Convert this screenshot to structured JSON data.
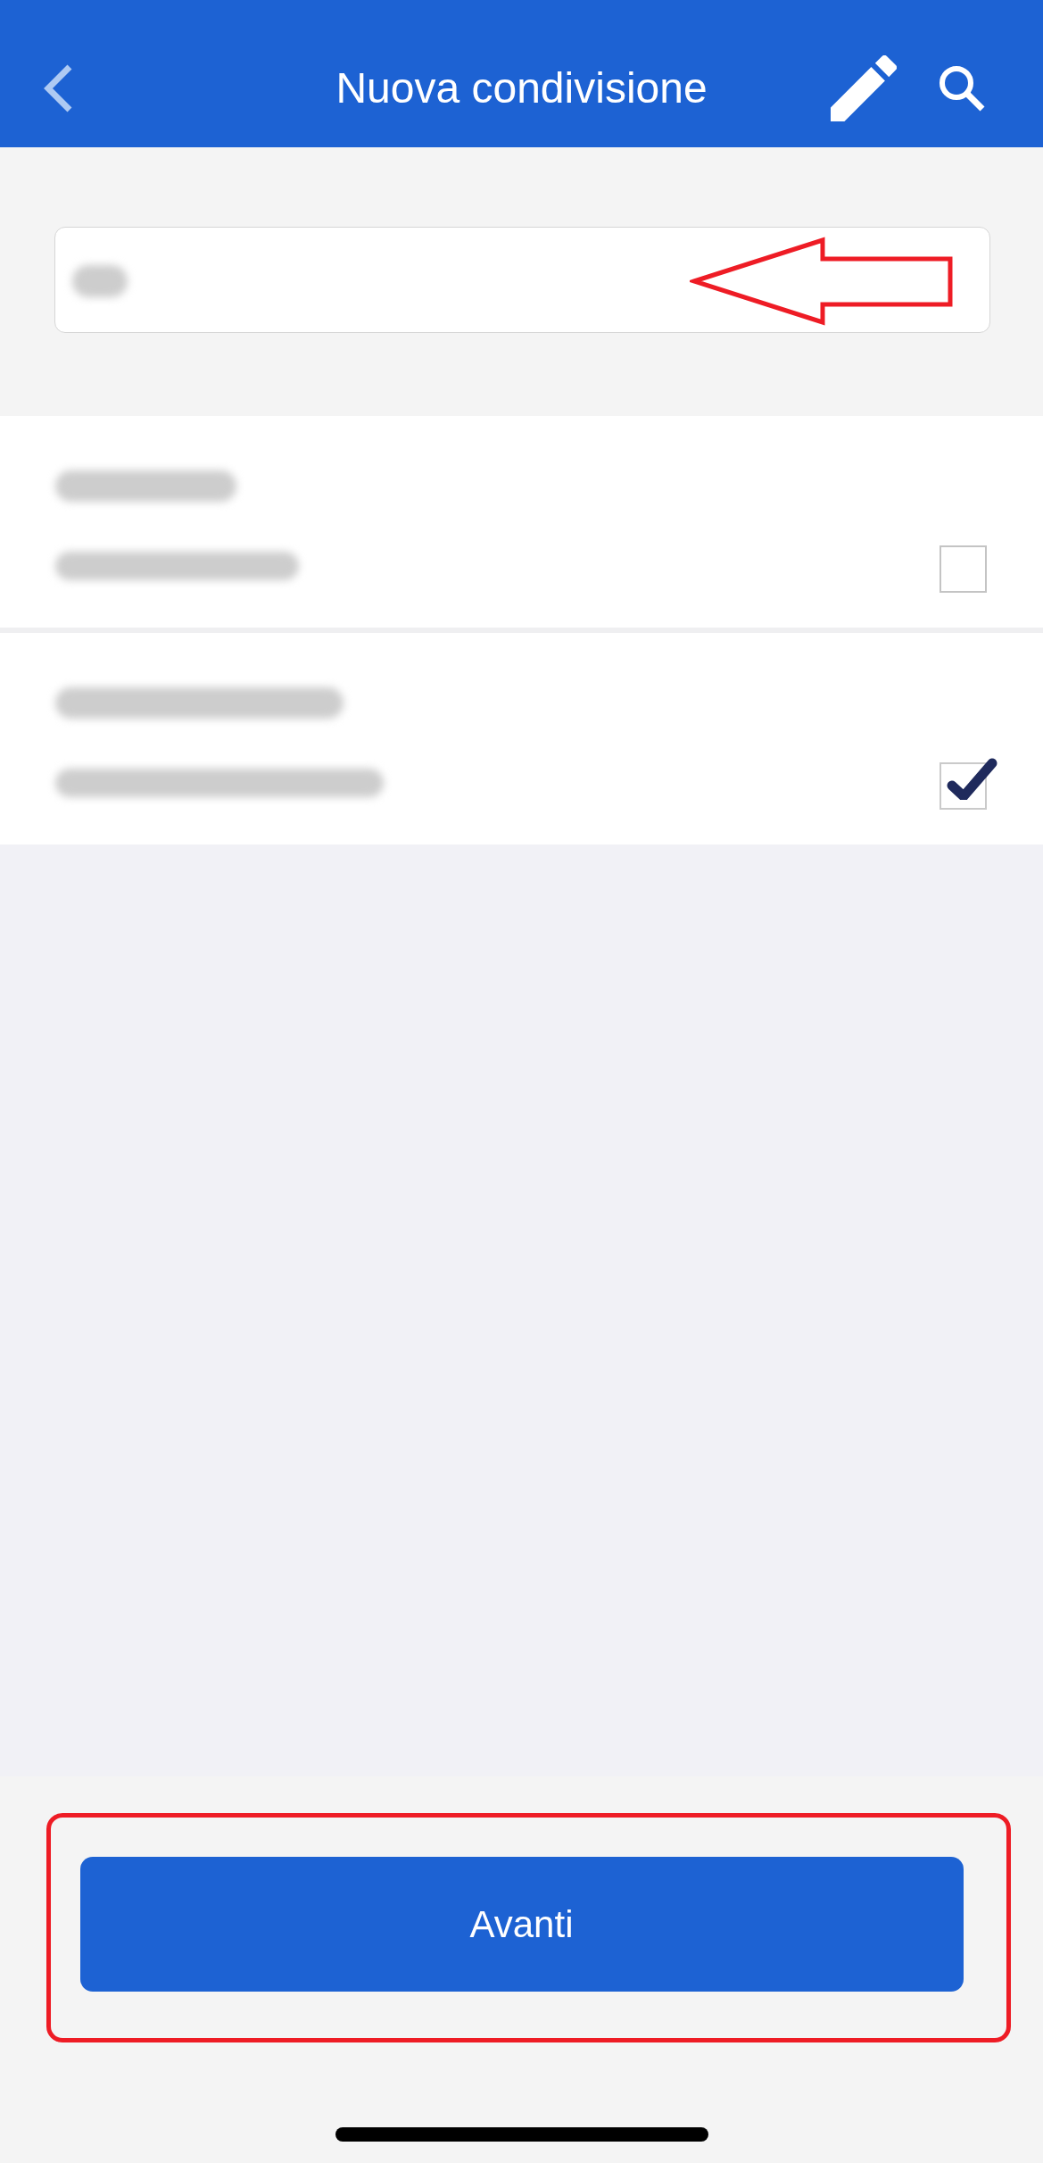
{
  "header": {
    "title": "Nuova condivisione"
  },
  "contacts": [
    {
      "checked": false
    },
    {
      "checked": true
    }
  ],
  "footer": {
    "button": "Avanti"
  },
  "annotations": [
    {
      "kind": "arrow"
    },
    {
      "kind": "frame"
    }
  ]
}
